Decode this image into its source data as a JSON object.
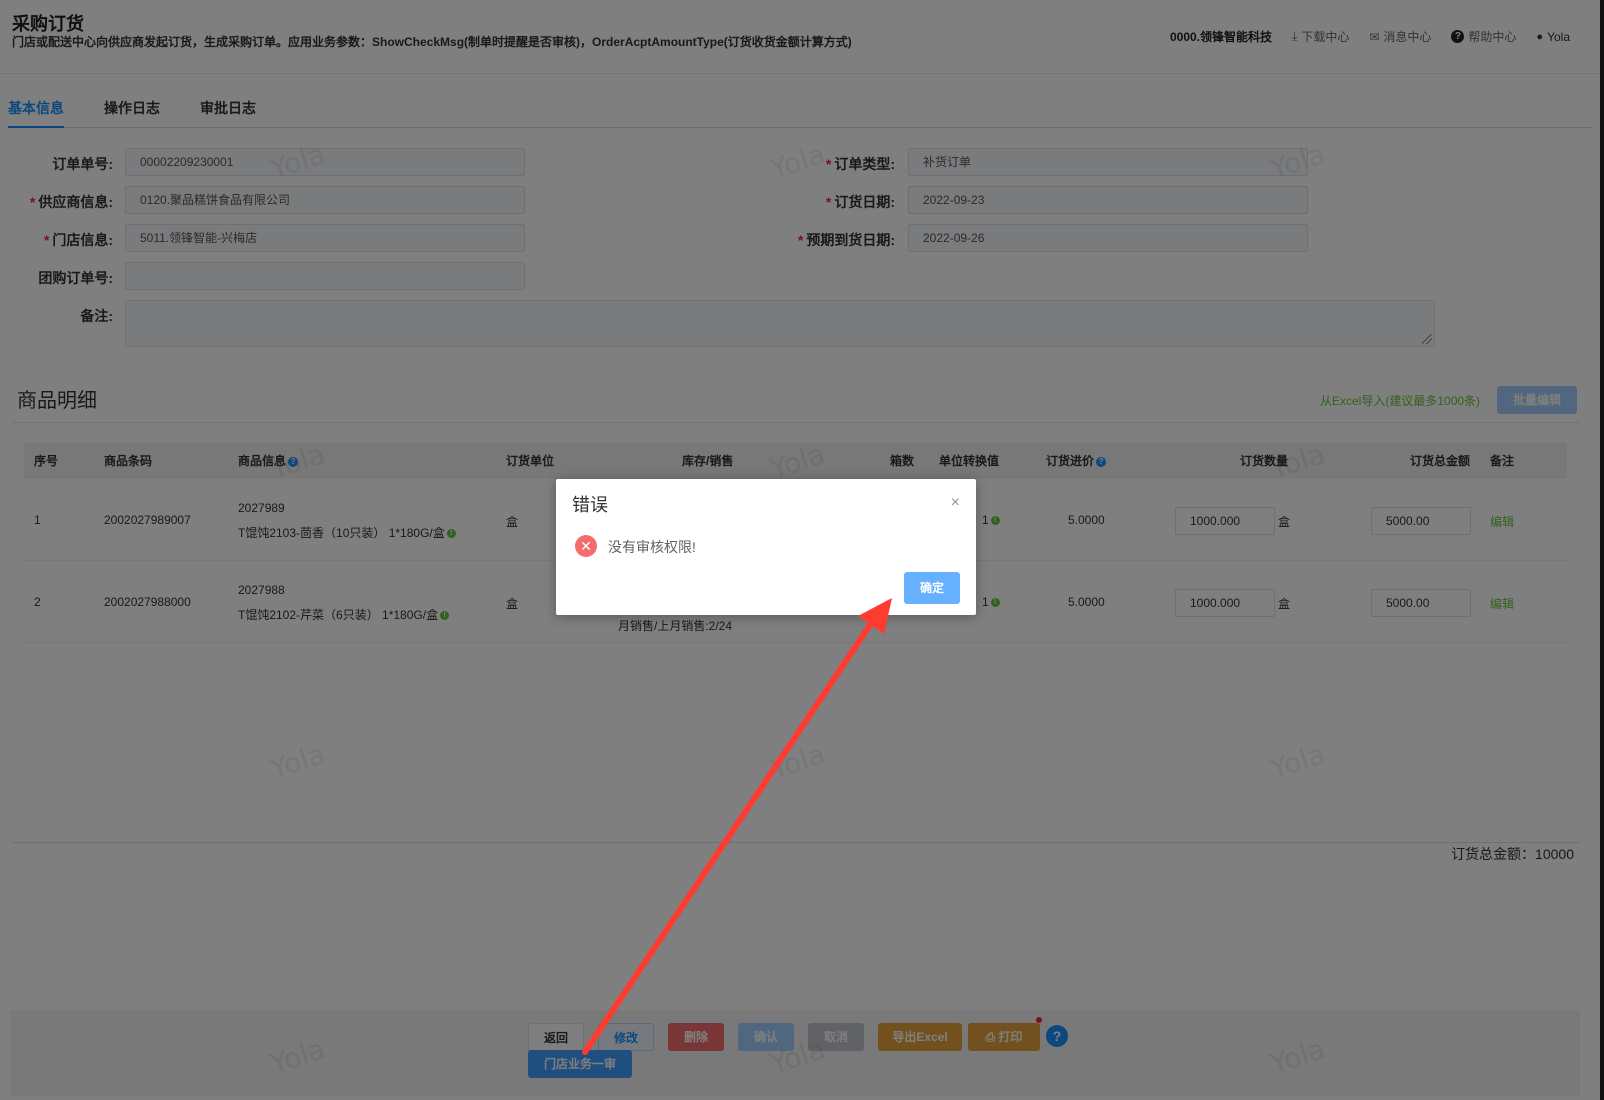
{
  "header": {
    "title": "采购订货",
    "description": "门店或配送中心向供应商发起订货，生成采购订单。应用业务参数：ShowCheckMsg(制单时提醒是否审核)，OrderAcptAmountType(订货收货金额计算方式)",
    "company": "0000.领锋智能科技",
    "download_center": "下载中心",
    "message_center": "消息中心",
    "help_center": "帮助中心",
    "user": "Yola"
  },
  "tabs": [
    {
      "label": "基本信息",
      "active": true
    },
    {
      "label": "操作日志",
      "active": false
    },
    {
      "label": "审批日志",
      "active": false
    }
  ],
  "form": {
    "order_no": {
      "label": "订单单号:",
      "value": "00002209230001"
    },
    "supplier": {
      "label": "供应商信息:",
      "value": "0120.聚品糕饼食品有限公司",
      "required": true
    },
    "store": {
      "label": "门店信息:",
      "value": "5011.领锋智能-兴梅店",
      "required": true
    },
    "group_order_no": {
      "label": "团购订单号:",
      "value": ""
    },
    "remark": {
      "label": "备注:",
      "value": ""
    },
    "order_type": {
      "label": "订单类型:",
      "value": "补货订单",
      "required": true
    },
    "order_date": {
      "label": "订货日期:",
      "value": "2022-09-23",
      "required": true
    },
    "expected_date": {
      "label": "预期到货日期:",
      "value": "2022-09-26",
      "required": true
    }
  },
  "goods": {
    "title": "商品明细",
    "import_link": "从Excel导入(建议最多1000条)",
    "batch_edit": "批量编辑",
    "columns": [
      "序号",
      "商品条码",
      "商品信息",
      "订货单位",
      "库存/销售",
      "箱数",
      "单位转换值",
      "订货进价",
      "订货数量",
      "订货总金额",
      "备注"
    ],
    "rows": [
      {
        "seq": "1",
        "barcode": "2002027989007",
        "code": "2027989",
        "name": "T馄饨2103-茴香（10只装） 1*180G/盒",
        "unit": "盒",
        "stock_sales": "",
        "conv": "1",
        "price": "5.0000",
        "qty": "1000.000",
        "qty_unit": "盒",
        "amount": "5000.00",
        "action": "编辑"
      },
      {
        "seq": "2",
        "barcode": "2002027988000",
        "code": "2027988",
        "name": "T馄饨2102-芹菜（6只装） 1*180G/盒",
        "unit": "盒",
        "stock_sales": "月销售/上月销售:2/24",
        "conv": "1",
        "price": "5.0000",
        "qty": "1000.000",
        "qty_unit": "盒",
        "amount": "5000.00",
        "action": "编辑"
      }
    ],
    "total_label": "订货总金额：10000"
  },
  "toolbar": {
    "back": "返回",
    "edit": "修改",
    "delete": "删除",
    "confirm": "确认",
    "cancel": "取消",
    "export": "导出Excel",
    "print": "打印",
    "first_audit": "门店业务一审",
    "help": "?"
  },
  "watermark": "Yola",
  "dialog": {
    "title": "错误",
    "message": "没有审核权限!",
    "ok": "确定",
    "close": "×"
  }
}
